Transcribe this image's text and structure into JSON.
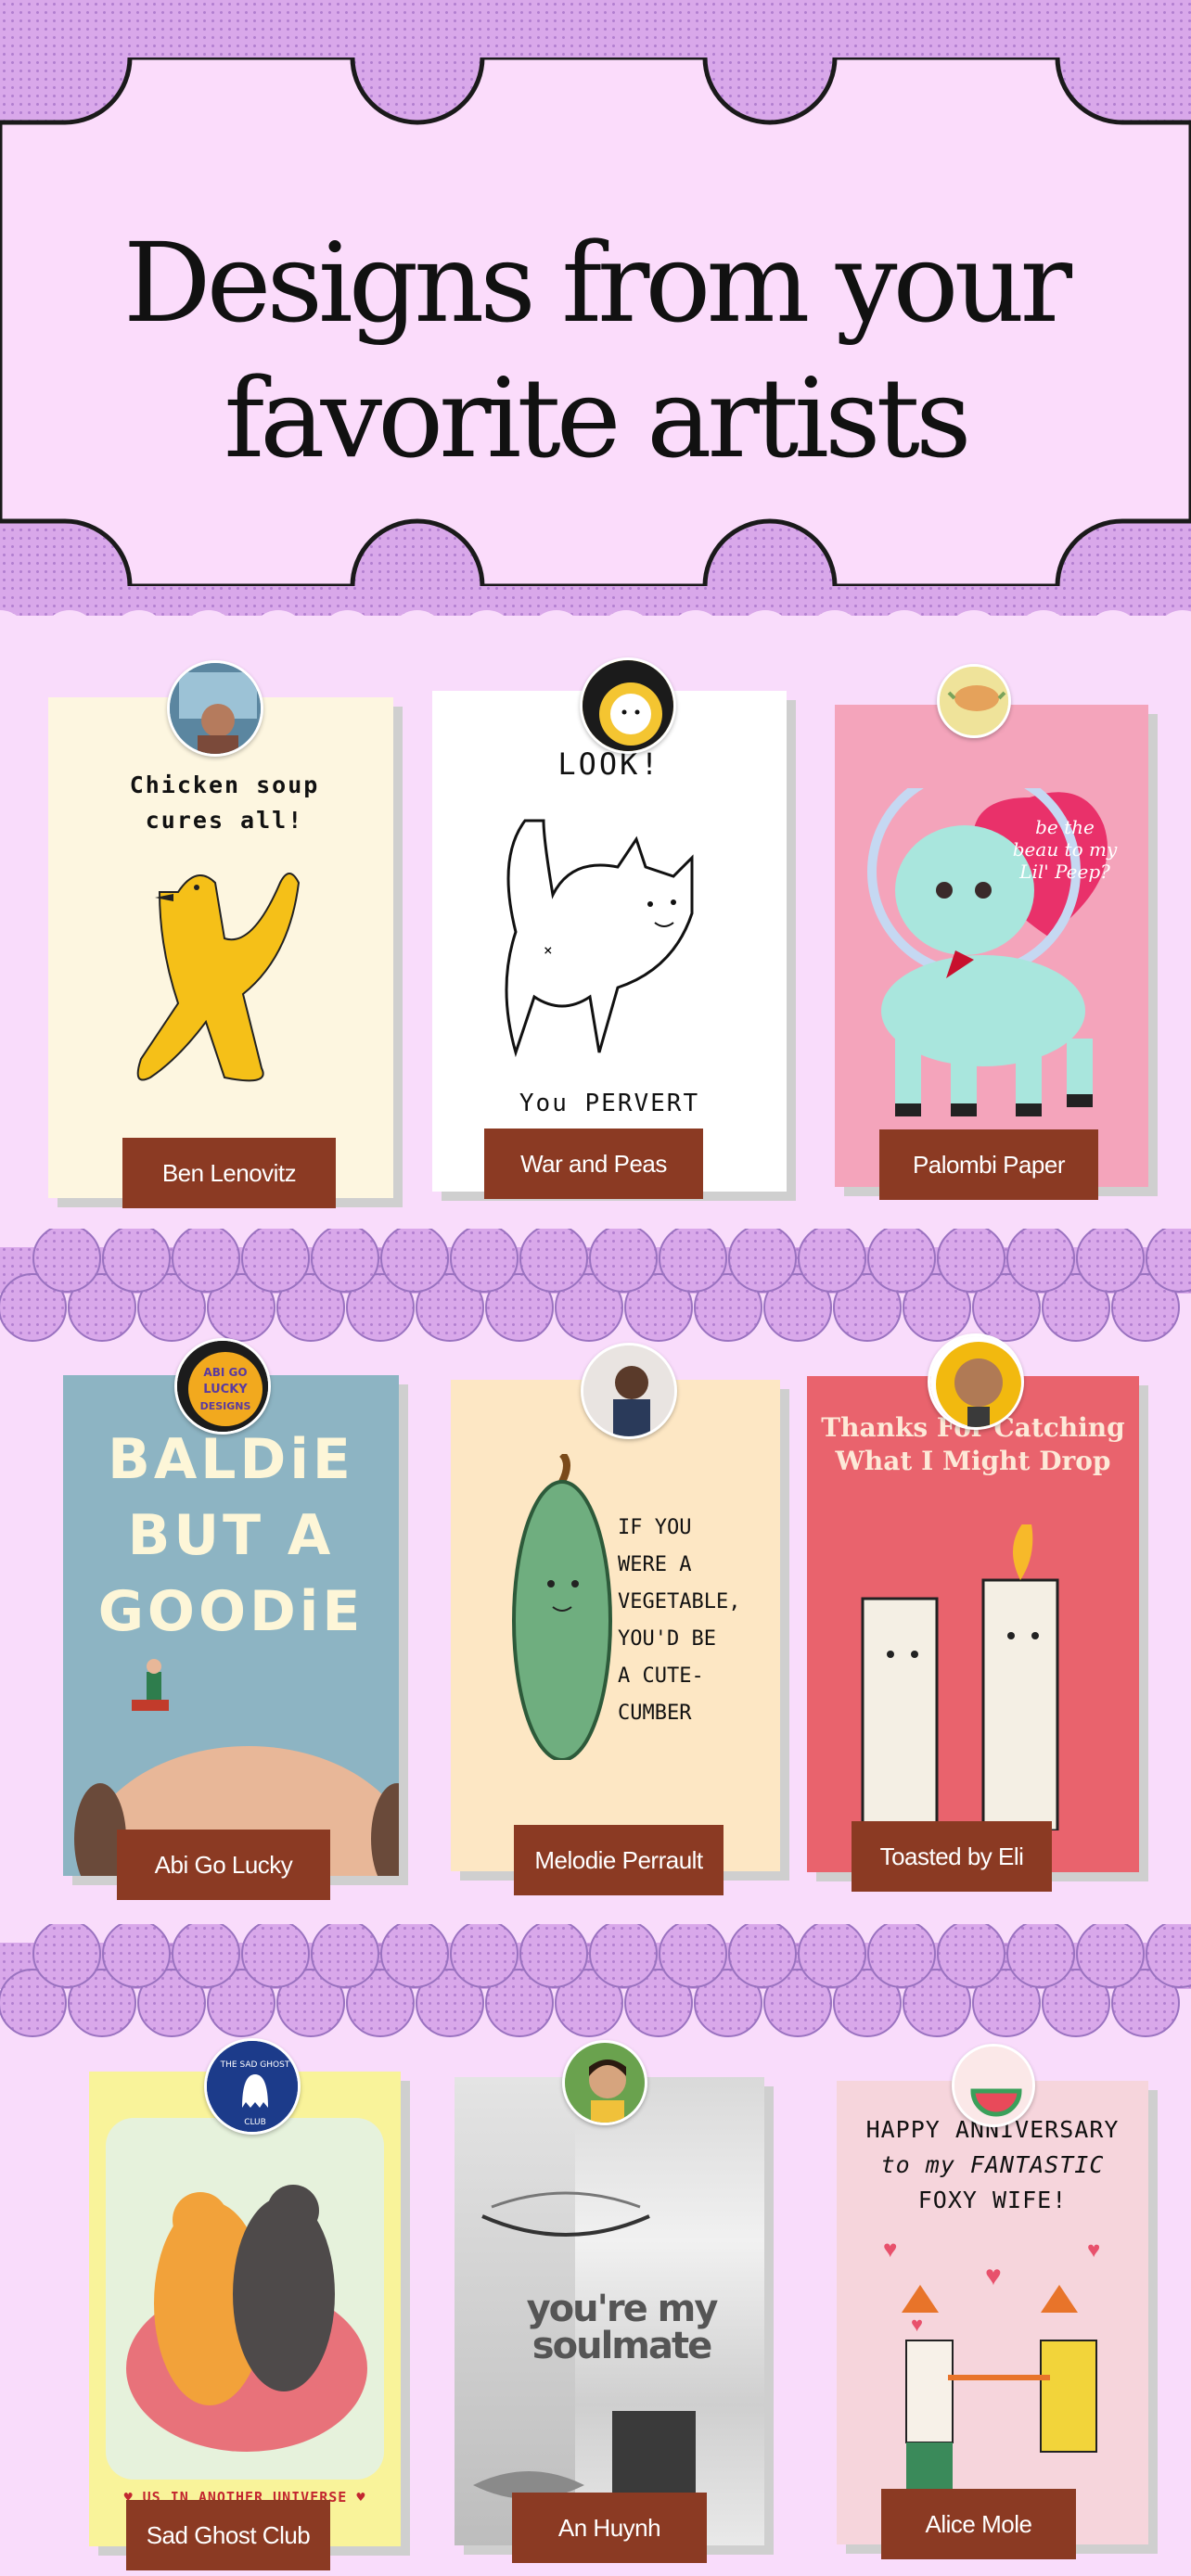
{
  "header": {
    "title_line1": "Designs from your",
    "title_line2": "favorite artists"
  },
  "cards": [
    {
      "artist": "Ben Lenovitz",
      "text": [
        "Chicken soup",
        "cures all!"
      ]
    },
    {
      "artist": "War and Peas",
      "text": [
        "LOOK!",
        "You PERVERT"
      ]
    },
    {
      "artist": "Palombi Paper",
      "text": [
        "be the",
        "beau to my",
        "Lil' Peep?"
      ]
    },
    {
      "artist": "Abi Go Lucky",
      "text": [
        "BALDiE",
        "BUT A",
        "GOODiE"
      ],
      "avatar_text": [
        "ABI GO",
        "LUCKY",
        "DESIGNS"
      ]
    },
    {
      "artist": "Melodie Perrault",
      "text": [
        "IF YOU",
        "WERE A",
        "VEGETABLE,",
        "YOU'D BE",
        "A CUTE-",
        "CUMBER"
      ]
    },
    {
      "artist": "Toasted by Eli",
      "text": [
        "Thanks For Catching",
        "What I Might Drop"
      ]
    },
    {
      "artist": "Sad Ghost Club",
      "text": [
        "US IN ANOTHER UNIVERSE"
      ],
      "avatar_text": [
        "THE SAD GHOST",
        "CLUB"
      ]
    },
    {
      "artist": "An Huynh",
      "text": [
        "you're my",
        "soulmate"
      ]
    },
    {
      "artist": "Alice Mole",
      "text": [
        "HAPPY ANNIVERSARY",
        "to my FANTASTIC",
        "FOXY WIFE!"
      ]
    }
  ]
}
